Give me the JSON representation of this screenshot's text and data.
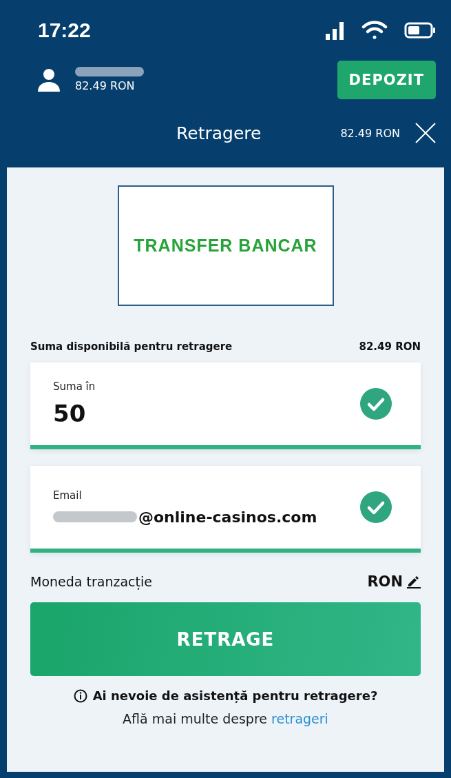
{
  "status_bar": {
    "time": "17:22"
  },
  "account": {
    "name_redacted": true,
    "balance": "82.49 RON",
    "deposit_button": "DEPOZIT"
  },
  "header": {
    "title": "Retragere",
    "balance": "82.49 RON"
  },
  "method": {
    "label": "TRANSFER BANCAR",
    "selected": true
  },
  "available": {
    "label": "Suma disponibilă pentru retragere",
    "value": "82.49 RON"
  },
  "fields": [
    {
      "kind": "amount",
      "label": "Suma în",
      "value": "50",
      "redacted_prefix": false,
      "valid": true
    },
    {
      "kind": "email",
      "label": "Email",
      "value": "@online-casinos.com",
      "redacted_prefix": true,
      "valid": true
    }
  ],
  "currency": {
    "label": "Moneda tranzacție",
    "value": "RON"
  },
  "submit": "RETRAGE",
  "help": {
    "question": "Ai nevoie de asistență pentru retragere?",
    "text": "Află mai multe despre",
    "link": "retrageri"
  }
}
